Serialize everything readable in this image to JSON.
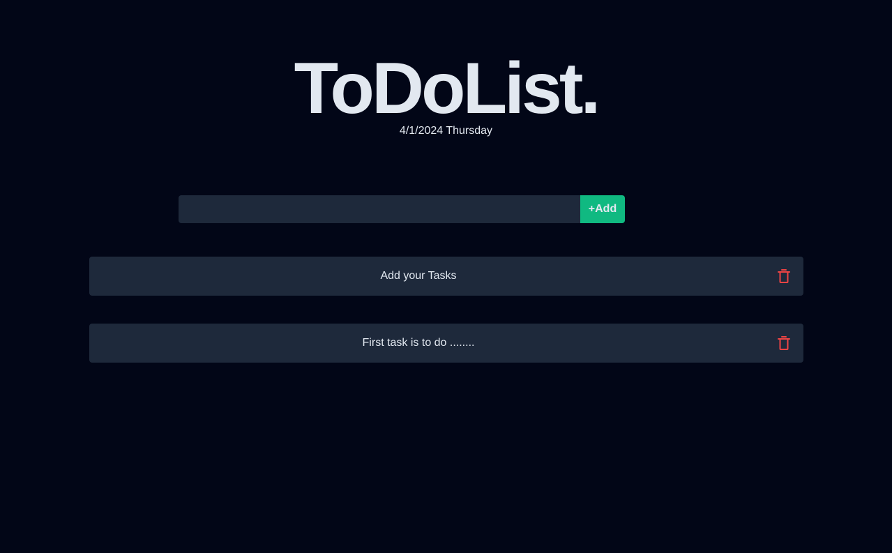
{
  "header": {
    "title": "ToDoList.",
    "date": "4/1/2024 Thursday"
  },
  "add_task": {
    "input_value": "",
    "placeholder": "",
    "button_label": "+Add"
  },
  "tasks": [
    {
      "text": "Add your Tasks",
      "delete_icon": "trash-icon"
    },
    {
      "text": "First task is to do ........",
      "delete_icon": "trash-icon"
    }
  ],
  "colors": {
    "background": "#020617",
    "surface": "#1e293b",
    "text": "#e2e8f0",
    "accent": "#10b981",
    "danger": "#ef4444"
  }
}
